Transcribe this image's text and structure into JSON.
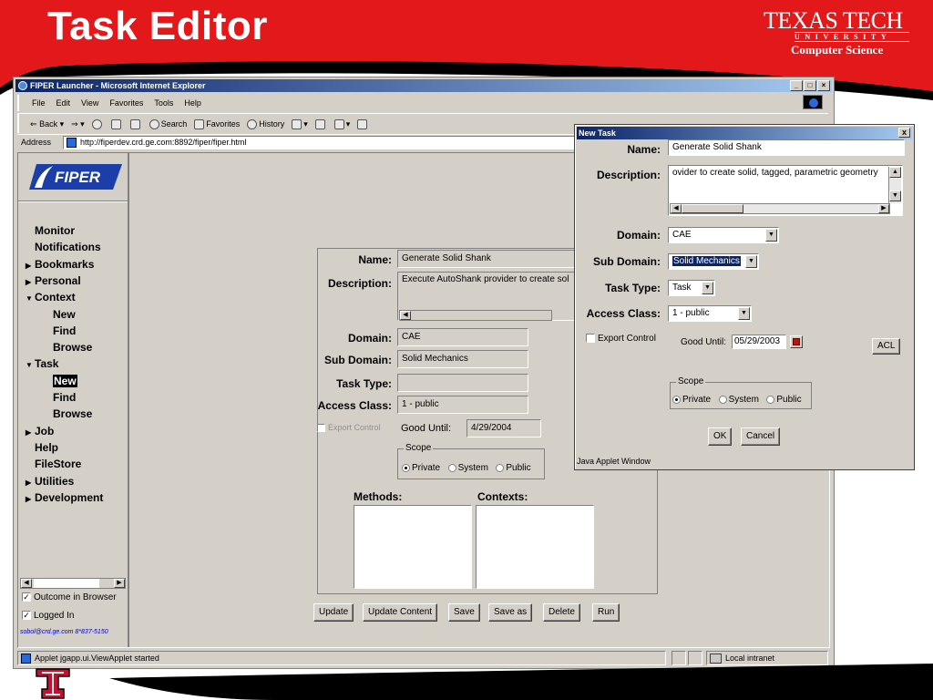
{
  "slide": {
    "title": "Task Editor",
    "logo": {
      "main": "TEXAS TECH",
      "univ": "UNIVERSITY",
      "dept": "Computer Science"
    },
    "colors": {
      "brand_red": "#e2181b",
      "title_text": "#ffffff",
      "window_title": "#0a246a",
      "panel_gray": "#d4d0c8"
    }
  },
  "browser": {
    "title": "FIPER Launcher - Microsoft Internet Explorer",
    "window_buttons": [
      "_",
      "̸",
      "×"
    ],
    "menu": [
      "File",
      "Edit",
      "View",
      "Favorites",
      "Tools",
      "Help"
    ],
    "toolbar": {
      "back": "Back",
      "search": "Search",
      "favorites": "Favorites",
      "history": "History"
    },
    "address_label": "Address",
    "address": "http://fiperdev.crd.ge.com:8892/fiper/fiper.html",
    "status": {
      "message": "Applet jgapp.ui.ViewApplet started",
      "zone": "Local intranet"
    }
  },
  "nav": {
    "logo_text": "FIPER",
    "items": [
      {
        "label": "Monitor",
        "arrow": ""
      },
      {
        "label": "Notifications",
        "arrow": ""
      },
      {
        "label": "Bookmarks",
        "arrow": "▶"
      },
      {
        "label": "Personal",
        "arrow": "▶"
      },
      {
        "label": "Context",
        "arrow": "▼"
      },
      {
        "label": "New",
        "arrow": ""
      },
      {
        "label": "Find",
        "arrow": ""
      },
      {
        "label": "Browse",
        "arrow": ""
      },
      {
        "label": "Task",
        "arrow": "▼"
      },
      {
        "label": "New",
        "arrow": "",
        "selected": true
      },
      {
        "label": "Find",
        "arrow": ""
      },
      {
        "label": "Browse",
        "arrow": ""
      },
      {
        "label": "Job",
        "arrow": "▶"
      },
      {
        "label": "Help",
        "arrow": ""
      },
      {
        "label": "FileStore",
        "arrow": ""
      },
      {
        "label": "Utilities",
        "arrow": "▶"
      },
      {
        "label": "Development",
        "arrow": "▶"
      }
    ],
    "outcome_in_browser": "Outcome in Browser",
    "logged_in": "Logged In",
    "email": "sobol@crd.ge.com 8*837-5150"
  },
  "task_form": {
    "name_label": "Name:",
    "name": "Generate Solid Shank",
    "description_label": "Description:",
    "description": "Execute AutoShank provider to create sol",
    "domain_label": "Domain:",
    "domain": "CAE",
    "subdomain_label": "Sub Domain:",
    "subdomain": "Solid Mechanics",
    "tasktype_label": "Task Type:",
    "tasktype": "",
    "access_label": "Access Class:",
    "access": "1 - public",
    "export_control": "Export Control",
    "good_until_label": "Good Until:",
    "good_until": "4/29/2004",
    "scope_label": "Scope",
    "scope_options": [
      "Private",
      "System",
      "Public"
    ],
    "methods_label": "Methods:",
    "contexts_label": "Contexts:",
    "buttons": [
      "Update",
      "Update Content",
      "Save",
      "Save as",
      "Delete",
      "Run"
    ]
  },
  "new_task_dialog": {
    "title": "New Task",
    "close": "x",
    "name_label": "Name:",
    "name": "Generate Solid Shank",
    "description_label": "Description:",
    "description": "ovider to create solid, tagged, parametric geometry",
    "domain_label": "Domain:",
    "domain": "CAE",
    "subdomain_label": "Sub Domain:",
    "subdomain": "Solid Mechanics",
    "tasktype_label": "Task Type:",
    "tasktype": "Task",
    "access_label": "Access Class:",
    "access": "1 - public",
    "export_control": "Export Control",
    "good_until_label": "Good Until:",
    "good_until": "05/29/2003",
    "acl_button": "ACL",
    "scope_label": "Scope",
    "scope_options": [
      "Private",
      "System",
      "Public"
    ],
    "ok": "OK",
    "cancel": "Cancel",
    "footer": "Java Applet Window"
  }
}
